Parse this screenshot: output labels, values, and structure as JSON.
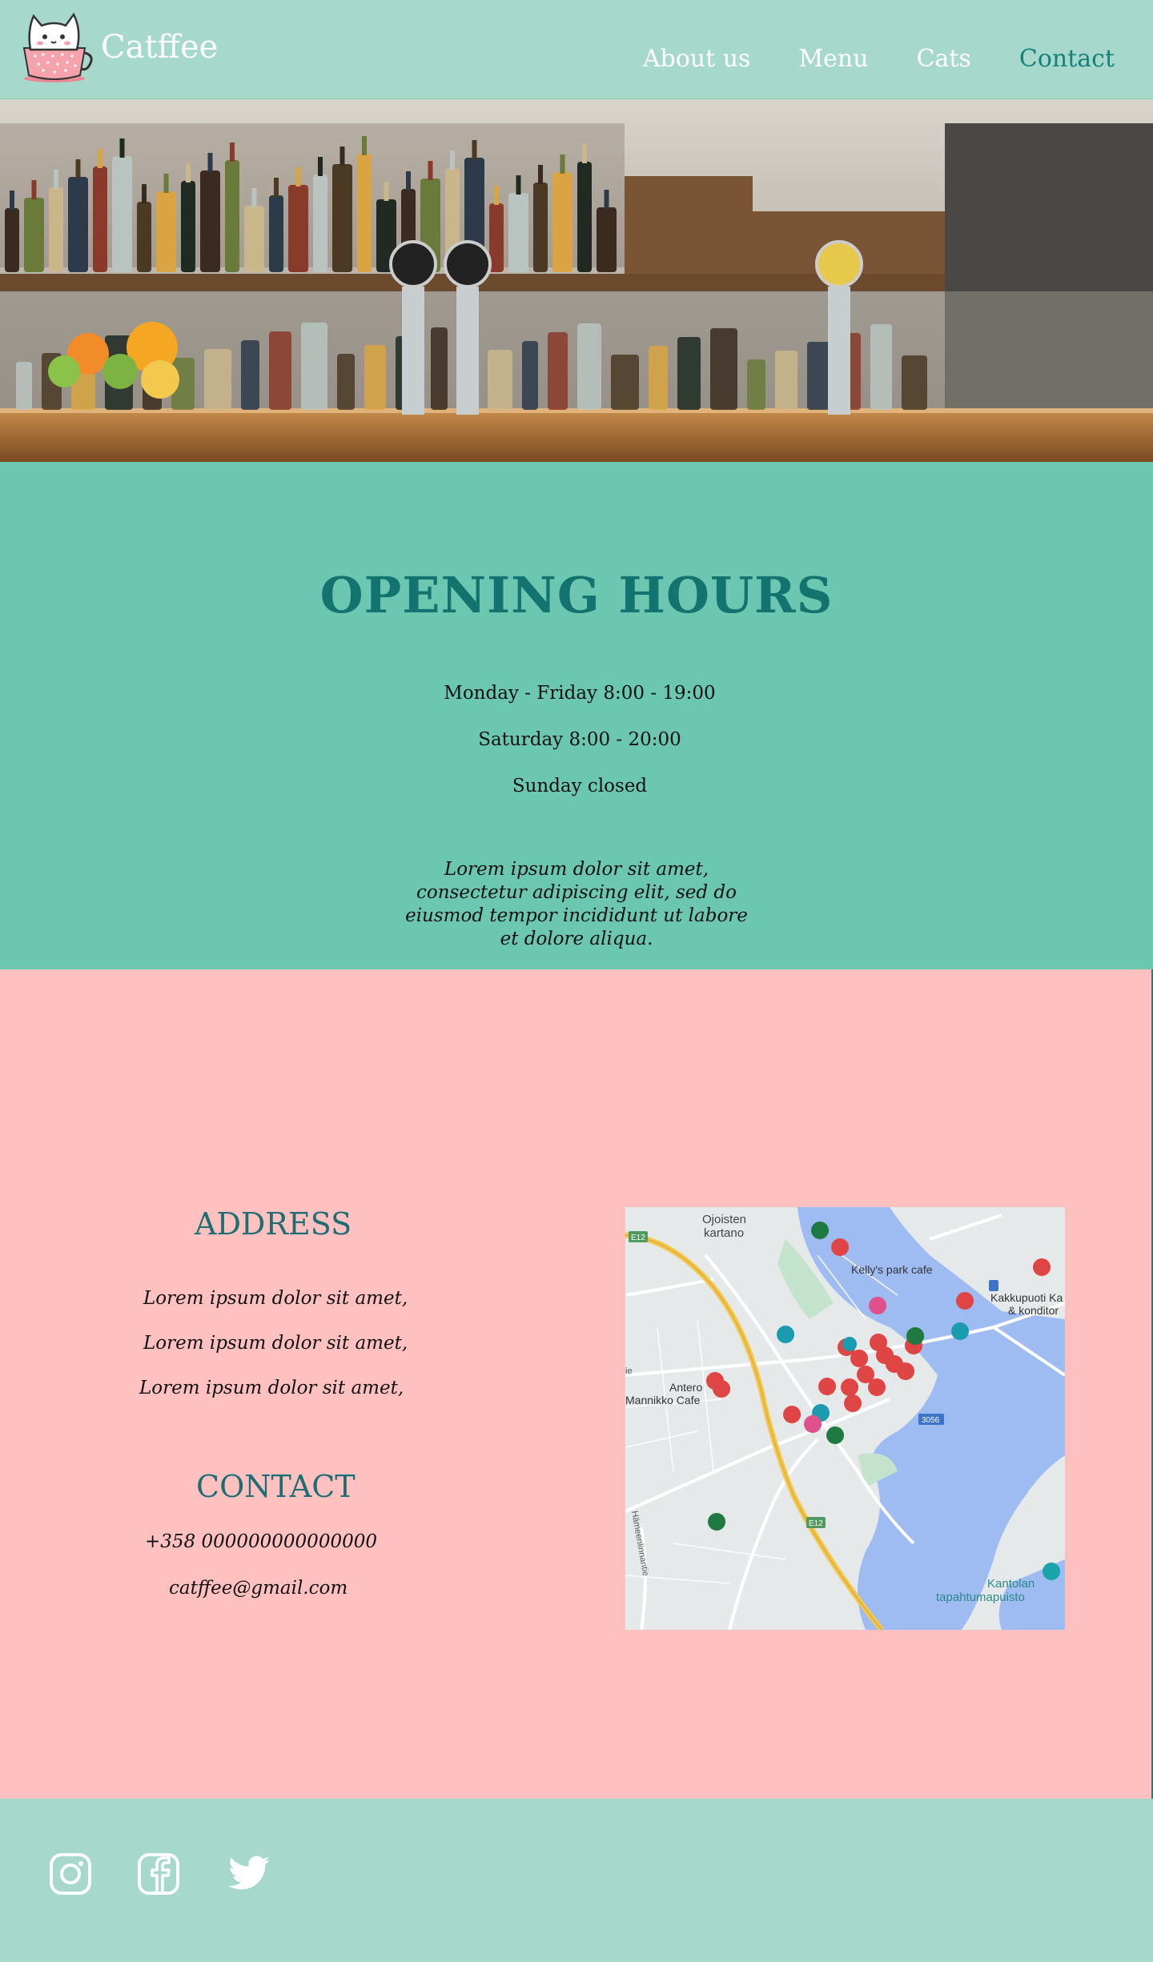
{
  "header": {
    "brand": "Catffee",
    "nav": [
      {
        "label": "About us"
      },
      {
        "label": "Menu"
      },
      {
        "label": "Cats"
      },
      {
        "label": "Contact"
      }
    ]
  },
  "hours": {
    "title": "OPENING HOURS",
    "lines": [
      "Monday - Friday 8:00 - 19:00",
      "Saturday 8:00 - 20:00",
      "Sunday closed"
    ],
    "lorem": "Lorem ipsum dolor sit amet, consectetur adipiscing elit, sed do eiusmod tempor incididunt ut labore et dolore aliqua."
  },
  "address": {
    "title": "ADDRESS",
    "lines": [
      "Lorem ipsum dolor sit amet,",
      "Lorem ipsum dolor sit amet,",
      "Lorem ipsum dolor sit amet,"
    ]
  },
  "contact": {
    "title": "CONTACT",
    "phone": "+358 000000000000000",
    "email": "catffee@gmail.com"
  },
  "map": {
    "labels": {
      "ojoisten": "Ojoisten",
      "kartano": "kartano",
      "kellys": "Kelly's park cafe",
      "kakku1": "Kakkupuoti Ka",
      "kakku2": "& konditor",
      "antero1": "Antero",
      "antero2": "Mannikko Cafe",
      "kantolan1": "Kantolan",
      "kantolan2": "tapahtumapuisto",
      "e12a": "E12",
      "e12b": "E12",
      "road3056": "3056",
      "hameenlinna": "Hämeenlinnantie",
      "ie": "ie"
    }
  },
  "footer": {
    "icons": [
      "instagram-icon",
      "facebook-icon",
      "twitter-icon"
    ]
  },
  "colors": {
    "header_bg": "#a6d9cb",
    "hours_bg": "#6cc7b0",
    "info_bg": "#ffc0c0",
    "accent": "#13736f",
    "heading": "#1d6e73"
  }
}
